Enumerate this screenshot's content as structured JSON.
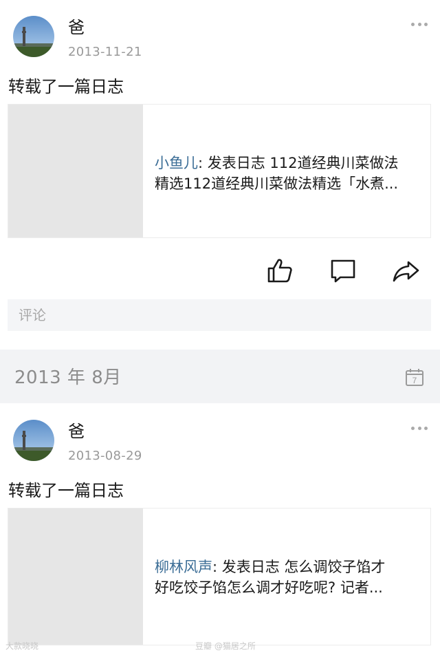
{
  "posts": [
    {
      "name": "爸",
      "date": "2013-11-21",
      "action": "转载了一篇日志",
      "card": {
        "author": "小鱼儿",
        "line1_rest": ": 发表日志 112道经典川菜做法",
        "line2": "精选112道经典川菜做法精选「水煮..."
      }
    },
    {
      "name": "爸",
      "date": "2013-08-29",
      "action": "转载了一篇日志",
      "card": {
        "author": "柳林风声",
        "line1_rest": ": 发表日志 怎么调饺子馅才",
        "line2": "好吃饺子馅怎么调才好吃呢? 记者..."
      }
    }
  ],
  "comment": {
    "placeholder": "评论"
  },
  "month_header": {
    "label": "2013 年 8月",
    "calendar_day": "7"
  },
  "icons": [
    "more-icon",
    "thumbs-up-icon",
    "comment-icon",
    "share-icon",
    "calendar-icon"
  ],
  "colors": {
    "author_link": "#3b6d96",
    "muted": "#999999",
    "section_bg": "#f2f3f5"
  },
  "watermarks": {
    "left": "大款晓晓",
    "right": "豆瓣 @猫居之所"
  }
}
